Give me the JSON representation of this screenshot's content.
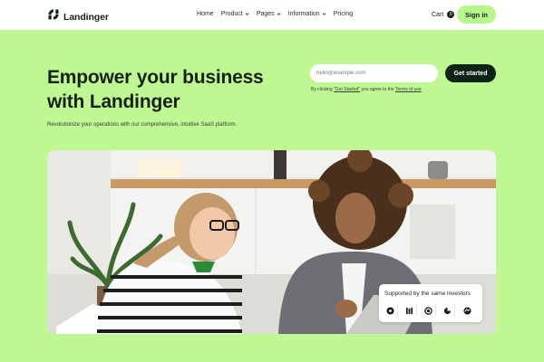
{
  "brand": {
    "name": "Landinger",
    "icon": "brand-logo-icon"
  },
  "nav": {
    "items": [
      {
        "label": "Home",
        "dropdown": false
      },
      {
        "label": "Product",
        "dropdown": true
      },
      {
        "label": "Pages",
        "dropdown": true
      },
      {
        "label": "Information",
        "dropdown": true
      },
      {
        "label": "Pricing",
        "dropdown": false
      }
    ],
    "cart_label": "Cart",
    "cart_count": "0",
    "signin_label": "Sign in"
  },
  "hero": {
    "headline": "Empower your business with Landinger",
    "lede": "Revolutionize your operations with our comprehensive, intuitive SaaS platform.",
    "email_placeholder": "hello@example.com",
    "cta_label": "Get started",
    "legal_prefix": "By clicking ",
    "legal_link_cta": "\"Get Started\"",
    "legal_mid": " you agree to the ",
    "legal_link_terms": "Terms of use",
    "image_icon": "office-photo"
  },
  "investors": {
    "title": "Supported by the same investors",
    "logos": [
      "investor-logo-1",
      "investor-logo-2",
      "investor-logo-3",
      "investor-logo-4",
      "investor-logo-5"
    ]
  },
  "colors": {
    "page_bg": "#bff792",
    "accent": "#b6f88c",
    "dark": "#0f2419",
    "text": "#16211b"
  }
}
